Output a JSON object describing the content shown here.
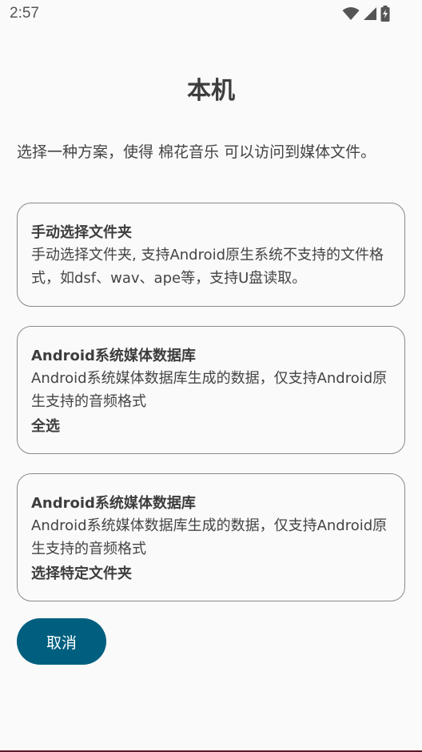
{
  "status_bar": {
    "time": "2:57",
    "icons": [
      "wifi-icon",
      "signal-icon",
      "battery-charging-icon"
    ]
  },
  "title": "本机",
  "intro": "选择一种方案，使得 棉花音乐 可以访问到媒体文件。",
  "options": [
    {
      "title": "手动选择文件夹",
      "description": "手动选择文件夹, 支持Android原生系统不支持的文件格式，如dsf、wav、ape等，支持U盘读取。",
      "action": ""
    },
    {
      "title": "Android系统媒体数据库",
      "description": "Android系统媒体数据库生成的数据，仅支持Android原生支持的音频格式",
      "action": "全选"
    },
    {
      "title": "Android系统媒体数据库",
      "description": "Android系统媒体数据库生成的数据，仅支持Android原生支持的音频格式",
      "action": "选择特定文件夹"
    }
  ],
  "cancel_label": "取消",
  "colors": {
    "background": "#fafafa",
    "accent": "#005f7f",
    "text": "#444444",
    "border": "#8a8a8a"
  }
}
